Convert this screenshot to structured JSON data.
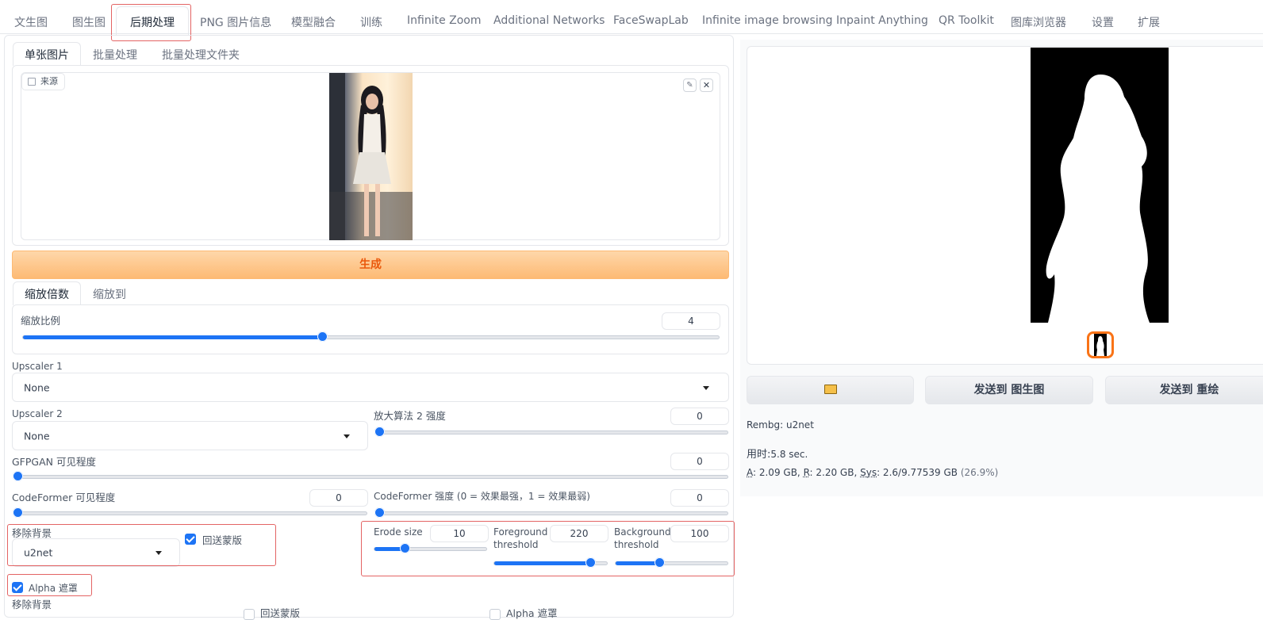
{
  "top_tabs": [
    {
      "label": "文生图"
    },
    {
      "label": "图生图"
    },
    {
      "label": "后期处理",
      "active": true
    },
    {
      "label": "PNG 图片信息"
    },
    {
      "label": "模型融合"
    },
    {
      "label": "训练"
    },
    {
      "label": "Infinite Zoom"
    },
    {
      "label": "Additional Networks"
    },
    {
      "label": "FaceSwapLab"
    },
    {
      "label": "Infinite image browsing"
    },
    {
      "label": "Inpaint Anything"
    },
    {
      "label": "QR Toolkit"
    },
    {
      "label": "图库浏览器"
    },
    {
      "label": "设置"
    },
    {
      "label": "扩展"
    }
  ],
  "sub_tabs": [
    "单张图片",
    "批量处理",
    "批量处理文件夹"
  ],
  "source": {
    "label": "来源",
    "icon": "image-icon"
  },
  "generate_label": "生成",
  "scale_tabs": [
    "缩放倍数",
    "缩放到"
  ],
  "scale": {
    "label": "缩放比例",
    "value": "4",
    "fraction": 0.43
  },
  "upscaler1": {
    "label": "Upscaler 1",
    "value": "None"
  },
  "upscaler2": {
    "label": "Upscaler 2",
    "value": "None"
  },
  "upscaler2_strength": {
    "label": "放大算法 2 强度",
    "value": "0",
    "fraction": 0
  },
  "gfpgan": {
    "label": "GFPGAN 可见程度",
    "value": "0",
    "fraction": 0
  },
  "codeformer_vis": {
    "label": "CodeFormer 可见程度",
    "value": "0",
    "fraction": 0
  },
  "codeformer_weight": {
    "label": "CodeFormer 强度 (0 = 效果最强，1 = 效果最弱)",
    "value": "0",
    "fraction": 0
  },
  "rembg": {
    "label": "移除背景",
    "value": "u2net",
    "return_mask_label": "回送蒙版",
    "return_mask": true
  },
  "erode": {
    "label": "Erode size",
    "value": "10",
    "fraction": 0.27
  },
  "fg_threshold": {
    "label_line1": "Foreground",
    "label_line2": "threshold",
    "value": "220",
    "fraction": 0.85
  },
  "bg_threshold": {
    "label_line1": "Background",
    "label_line2": "threshold",
    "value": "100",
    "fraction": 0.39
  },
  "alpha_mask": {
    "label": "Alpha 遮罩",
    "checked": true
  },
  "rembg2": {
    "label": "移除背景",
    "return_mask_label": "回送蒙版",
    "alpha_label": "Alpha 遮罩"
  },
  "output": {
    "buttons": {
      "folder_icon": "folder-icon",
      "send_img2img": "发送到 图生图",
      "send_inpaint": "发送到 重绘"
    },
    "rembg_info": "Rembg: u2net",
    "time_label": "用时:",
    "time_value": "5.8 sec.",
    "memory": {
      "a_label": "A",
      "a_value": ": 2.09 GB, ",
      "r_label": "R",
      "r_value": ": 2.20 GB, ",
      "sys_label": "Sys",
      "sys_value": ": 2.6/9.77539 GB ",
      "pct": "(26.9%)"
    }
  },
  "colors": {
    "accent": "#1d74f5",
    "generate_bg": "#fdba74",
    "generate_text": "#ea580c",
    "highlight": "#e36464",
    "thumb_border": "#f97316"
  }
}
